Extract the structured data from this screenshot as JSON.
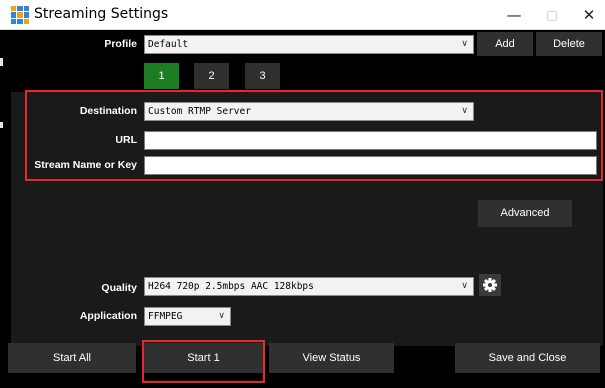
{
  "window": {
    "title": "Streaming Settings",
    "minimize_glyph": "—",
    "maximize_glyph": "□",
    "close_glyph": "✕"
  },
  "profile": {
    "label": "Profile",
    "value": "Default",
    "add_label": "Add",
    "delete_label": "Delete"
  },
  "tabs": [
    {
      "label": "1",
      "active": true
    },
    {
      "label": "2",
      "active": false
    },
    {
      "label": "3",
      "active": false
    }
  ],
  "destination": {
    "label": "Destination",
    "value": "Custom RTMP Server"
  },
  "url": {
    "label": "URL",
    "value": ""
  },
  "stream_key": {
    "label": "Stream Name or Key",
    "value": ""
  },
  "advanced_label": "Advanced",
  "quality": {
    "label": "Quality",
    "value": "H264 720p 2.5mbps AAC 128kbps"
  },
  "application": {
    "label": "Application",
    "value": "FFMPEG"
  },
  "footer": {
    "start_all": "Start All",
    "start_one": "Start 1",
    "view_status": "View Status",
    "save_close": "Save and Close"
  },
  "icons": {
    "app": "grid-app-icon",
    "settings": "gear-icon",
    "dropdown": "chevron-down-icon"
  },
  "colors": {
    "active_tab": "#1e7d22",
    "highlight": "#e8262f",
    "app_icon": [
      "#f0a21c",
      "#2f86d6",
      "#2f86d6",
      "#2f86d6",
      "#f0a21c",
      "#2f86d6",
      "#2f86d6",
      "#2f86d6",
      "#f0a21c"
    ]
  }
}
